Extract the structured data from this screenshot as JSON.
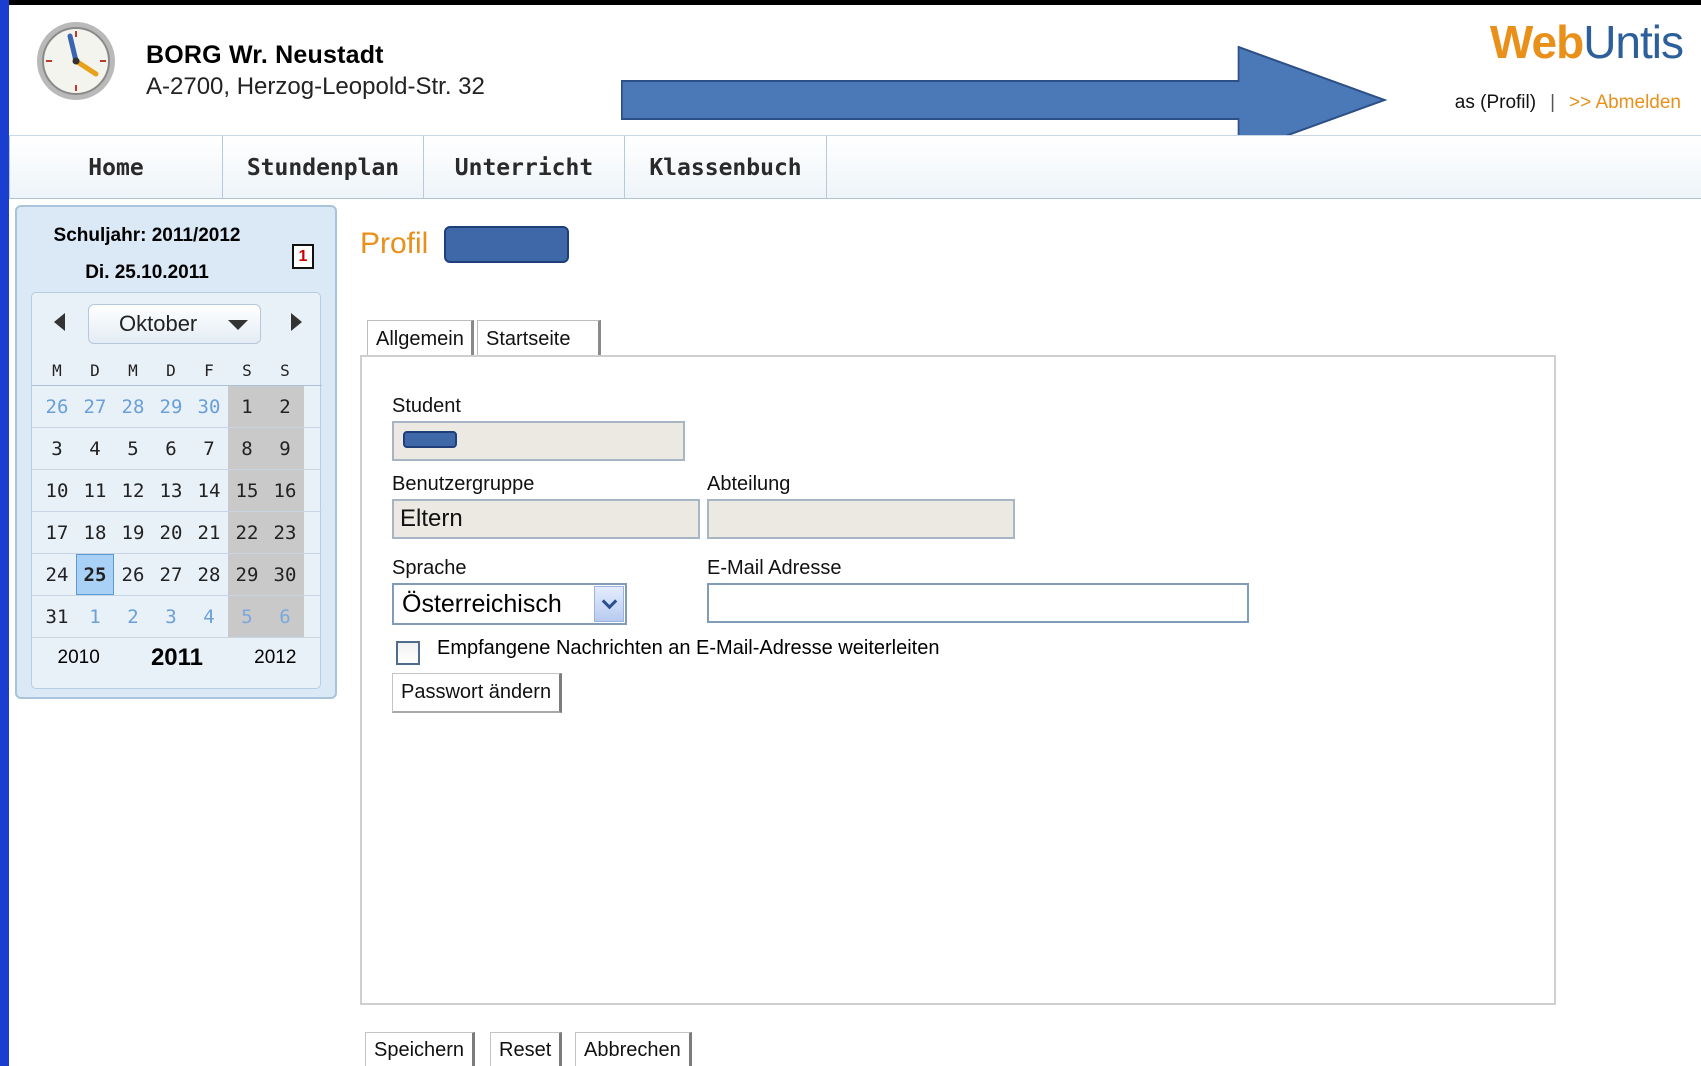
{
  "header": {
    "school_name": "BORG Wr. Neustadt",
    "school_address": "A-2700, Herzog-Leopold-Str. 32",
    "brand_web": "Web",
    "brand_untis": "Untis",
    "profile_link": "as (Profil)",
    "separator": "|",
    "logout_link": ">> Abmelden"
  },
  "nav": {
    "items": [
      {
        "label": "Home"
      },
      {
        "label": "Stundenplan"
      },
      {
        "label": "Unterricht"
      },
      {
        "label": "Klassenbuch"
      }
    ]
  },
  "calendar": {
    "school_year": "Schuljahr: 2011/2012",
    "current_date": "Di. 25.10.2011",
    "today_icon": "1",
    "month": "Oktober",
    "weekdays": [
      "M",
      "D",
      "M",
      "D",
      "F",
      "S",
      "S"
    ],
    "weeks": [
      [
        "26",
        "27",
        "28",
        "29",
        "30",
        "1",
        "2"
      ],
      [
        "3",
        "4",
        "5",
        "6",
        "7",
        "8",
        "9"
      ],
      [
        "10",
        "11",
        "12",
        "13",
        "14",
        "15",
        "16"
      ],
      [
        "17",
        "18",
        "19",
        "20",
        "21",
        "22",
        "23"
      ],
      [
        "24",
        "25",
        "26",
        "27",
        "28",
        "29",
        "30"
      ],
      [
        "31",
        "1",
        "2",
        "3",
        "4",
        "5",
        "6"
      ]
    ],
    "selected_day": "25",
    "years": {
      "prev": "2010",
      "current": "2011",
      "next": "2012"
    }
  },
  "profile": {
    "title": "Profil",
    "tabs": [
      {
        "label": "Allgemein"
      },
      {
        "label": "Startseite"
      }
    ],
    "student_label": "Student",
    "student_value": "",
    "group_label": "Benutzergruppe",
    "group_value": "Eltern",
    "department_label": "Abteilung",
    "department_value": "",
    "language_label": "Sprache",
    "language_value": "Österreichisch",
    "email_label": "E-Mail Adresse",
    "email_value": "",
    "forward_label": "Empfangene Nachrichten an E-Mail-Adresse weiterleiten",
    "forward_checked": false,
    "password_button": "Passwort ändern"
  },
  "actions": {
    "save": "Speichern",
    "reset": "Reset",
    "cancel": "Abbrechen"
  },
  "colors": {
    "frame_blue": "#1a3fd0",
    "brand_orange": "#e8901a",
    "brand_blue": "#2d5f9a",
    "redaction_blue": "#4b79b8"
  }
}
